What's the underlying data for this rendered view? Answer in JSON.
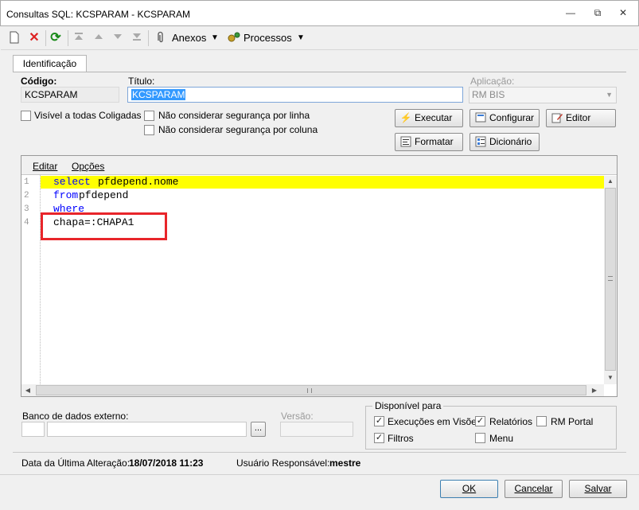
{
  "window": {
    "title": "Consultas SQL: KCSPARAM - KCSPARAM",
    "min_glyph": "—",
    "restore_glyph": "⧉",
    "close_glyph": "✕"
  },
  "toolbar": {
    "anexos_label": "Anexos",
    "processos_label": "Processos",
    "dropdown_glyph": "▼"
  },
  "tabs": {
    "identificacao": "Identificação"
  },
  "form": {
    "codigo_label": "Código:",
    "codigo_value": "KCSPARAM",
    "titulo_label": "Título:",
    "titulo_value": "KCSPARAM",
    "aplicacao_label": "Aplicação:",
    "aplicacao_value": "RM BIS",
    "visivel_label": "Visível a todas Coligadas",
    "nao_seg_linha_label": "Não considerar segurança por linha",
    "nao_seg_coluna_label": "Não considerar segurança por coluna"
  },
  "buttons": {
    "executar": "Executar",
    "configurar": "Configurar",
    "editor": "Editor",
    "formatar": "Formatar",
    "dicionario": "Dicionário"
  },
  "editor": {
    "menu_editar": "Editar",
    "menu_opcoes": "Opções",
    "lines": [
      {
        "num": "1",
        "kw": "select",
        "rest": " pfdepend.nome"
      },
      {
        "num": "2",
        "kw": "from",
        "rest": " pfdepend"
      },
      {
        "num": "3",
        "kw": "where",
        "rest": ""
      },
      {
        "num": "4",
        "kw": "",
        "rest": "chapa=:CHAPA1"
      }
    ]
  },
  "banco": {
    "label": "Banco de dados externo:",
    "browse_label": "...",
    "versao_label": "Versão:"
  },
  "disponivel": {
    "title": "Disponível para",
    "execucoes_label": "Execuções em Visões",
    "execucoes_checked": true,
    "relatorios_label": "Relatórios",
    "relatorios_checked": true,
    "rm_portal_label": "RM Portal",
    "rm_portal_checked": false,
    "filtros_label": "Filtros",
    "filtros_checked": true,
    "menu_label": "Menu",
    "menu_checked": false
  },
  "status": {
    "data_label": "Data da Última Alteração:",
    "data_value": "18/07/2018 11:23",
    "usuario_label": "Usuário Responsável:",
    "usuario_value": "mestre"
  },
  "footer": {
    "ok": "OK",
    "cancelar": "Cancelar",
    "salvar": "Salvar"
  },
  "colors": {
    "highlight_line": "#ffff00",
    "keyword": "#0000ff",
    "annotation_box": "#e8252a",
    "selection": "#3399ff"
  }
}
